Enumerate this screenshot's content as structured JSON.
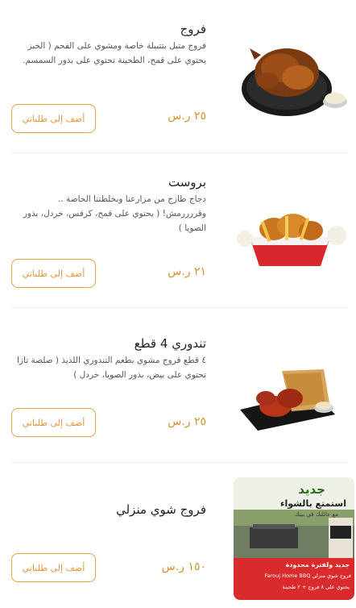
{
  "menu": {
    "items": [
      {
        "title": "فروج",
        "description": "فروج متبل بتتبيلة خاصة ومشوي على الفحم ( الخبز يحتوي على قمح، الطحينة تحتوي على بذور السمسم.",
        "price": "٢٥ ر.س",
        "button": "أضف إلى طلباتي",
        "image": "grilled-chicken-image"
      },
      {
        "title": "بروست",
        "description": "دجاج طازج من مزارعنا وبخلطتنا الخاصة .. وقررررمش! ( يحتوي على قمح، كرفس، خردل، بذور الصويا )",
        "price": "٢١ ر.س",
        "button": "أضف إلى طلباتي",
        "image": "broasted-chicken-image"
      },
      {
        "title": "تندوري 4 قطع",
        "description": "٤ قطع فروج مشوي بطعم التندوري اللذيذ ( صلصة تازا تحتوي على بيض، بذور الصويا، خردل )",
        "price": "٢٥ ر.س",
        "button": "أضف إلى طلباتي",
        "image": "tandoori-chicken-image"
      },
      {
        "title": "فروج شوي منزلي",
        "description": "",
        "price": "١٥٠ ر.س",
        "button": "أضف إلى طلباتي",
        "image": "home-bbq-promo-image",
        "promo": {
          "headline": "جديد",
          "tagline": "استمتع بالشواء",
          "subline": "مع عائلتك في بيتك",
          "offer": "جديد ولفترة محدودة",
          "product": "فروج شوي منزلي Farouj Home BBQ",
          "details": "يحتوي على ٨ فروج + ٢ طحينة"
        }
      }
    ]
  },
  "colors": {
    "accent": "#e3963b",
    "price": "#d4922f",
    "divider": "#ececec",
    "promo_red": "#d92b2b"
  }
}
